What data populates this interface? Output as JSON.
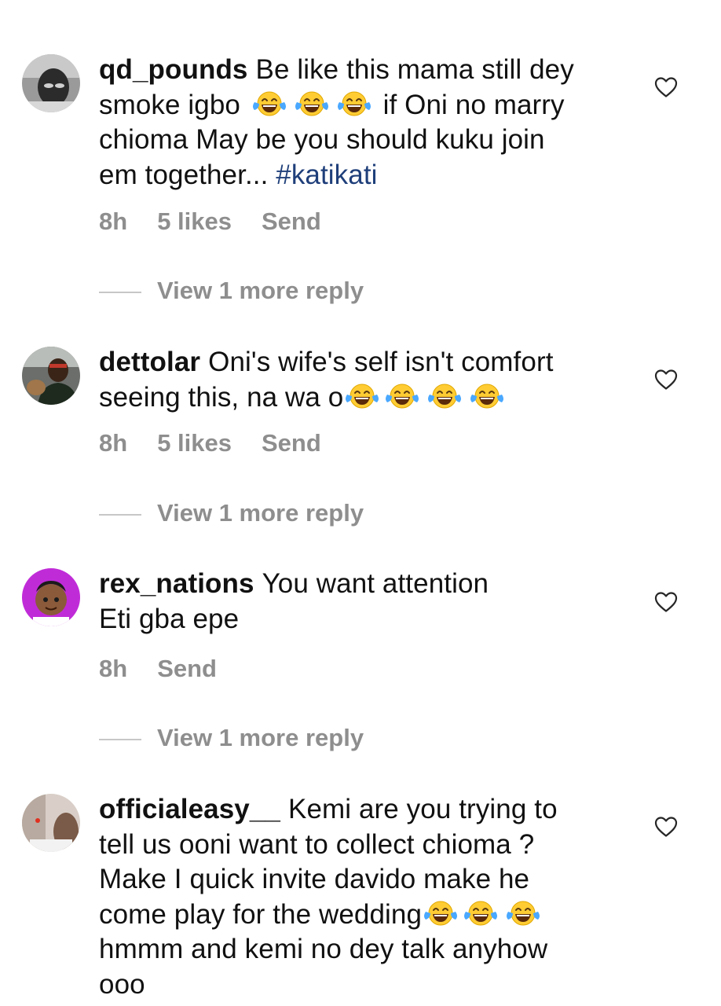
{
  "comments": [
    {
      "username": "qd_pounds",
      "lines": [
        "Be like this mama still dey",
        "smoke igbo",
        "if Oni no marry",
        "chioma May be you should kuku join",
        "em together...",
        "#katikati"
      ],
      "time": "8h",
      "likes": "5 likes",
      "send": "Send",
      "view_more": "View 1 more reply",
      "liked": false
    },
    {
      "username": "dettolar",
      "lines": [
        "Oni's wife's self isn't comfort",
        "seeing this, na wa o"
      ],
      "time": "8h",
      "likes": "5 likes",
      "send": "Send",
      "view_more": "View 1 more reply",
      "liked": false
    },
    {
      "username": "rex_nations",
      "lines": [
        "You want attention",
        "Eti gba epe"
      ],
      "time": "8h",
      "send": "Send",
      "view_more": "View 1 more reply",
      "liked": false
    },
    {
      "username": "officialeasy__",
      "lines": [
        "Kemi are you trying to",
        "tell us ooni want to collect chioma ?",
        "Make I quick invite davido make he",
        "come play for the wedding",
        "hmmm and kemi no dey talk anyhow",
        "ooo"
      ],
      "liked": false
    }
  ],
  "icons": {
    "emoji": "face-with-tears-of-joy-icon",
    "like": "heart-outline-icon"
  },
  "colors": {
    "text": "#111111",
    "meta": "#8e8e8e",
    "hashtag": "#1f3f7a",
    "divider": "#c7c7c7"
  }
}
